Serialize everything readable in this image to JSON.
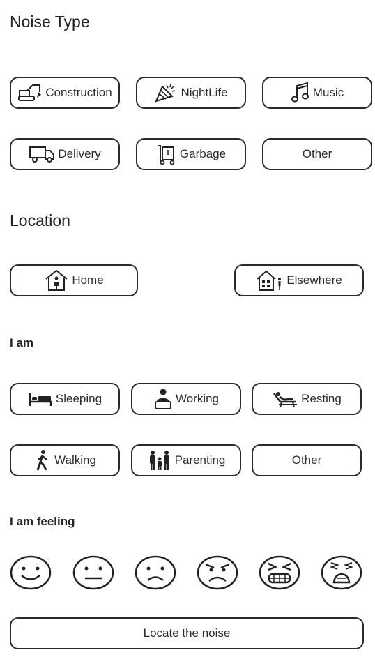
{
  "noise_type": {
    "heading": "Noise Type",
    "options": [
      {
        "label": "Construction",
        "icon": "excavator-icon"
      },
      {
        "label": "NightLife",
        "icon": "party-popper-icon"
      },
      {
        "label": "Music",
        "icon": "music-note-icon"
      },
      {
        "label": "Delivery",
        "icon": "delivery-truck-icon"
      },
      {
        "label": "Garbage",
        "icon": "garbage-cart-icon"
      },
      {
        "label": "Other",
        "icon": ""
      }
    ]
  },
  "location": {
    "heading": "Location",
    "options": [
      {
        "label": "Home",
        "icon": "home-person-icon"
      },
      {
        "label": "Elsewhere",
        "icon": "house-elsewhere-icon"
      }
    ]
  },
  "i_am": {
    "heading": "I am",
    "options": [
      {
        "label": "Sleeping",
        "icon": "bed-icon"
      },
      {
        "label": "Working",
        "icon": "desk-worker-icon"
      },
      {
        "label": "Resting",
        "icon": "recliner-icon"
      },
      {
        "label": "Walking",
        "icon": "walking-person-icon"
      },
      {
        "label": "Parenting",
        "icon": "family-icon"
      },
      {
        "label": "Other",
        "icon": ""
      }
    ]
  },
  "feeling": {
    "heading": "I am feeling",
    "faces": [
      "happy-face-icon",
      "neutral-face-icon",
      "sad-face-icon",
      "angry-face-icon",
      "grimacing-face-icon",
      "distressed-face-icon"
    ]
  },
  "locate_button": "Locate the noise"
}
